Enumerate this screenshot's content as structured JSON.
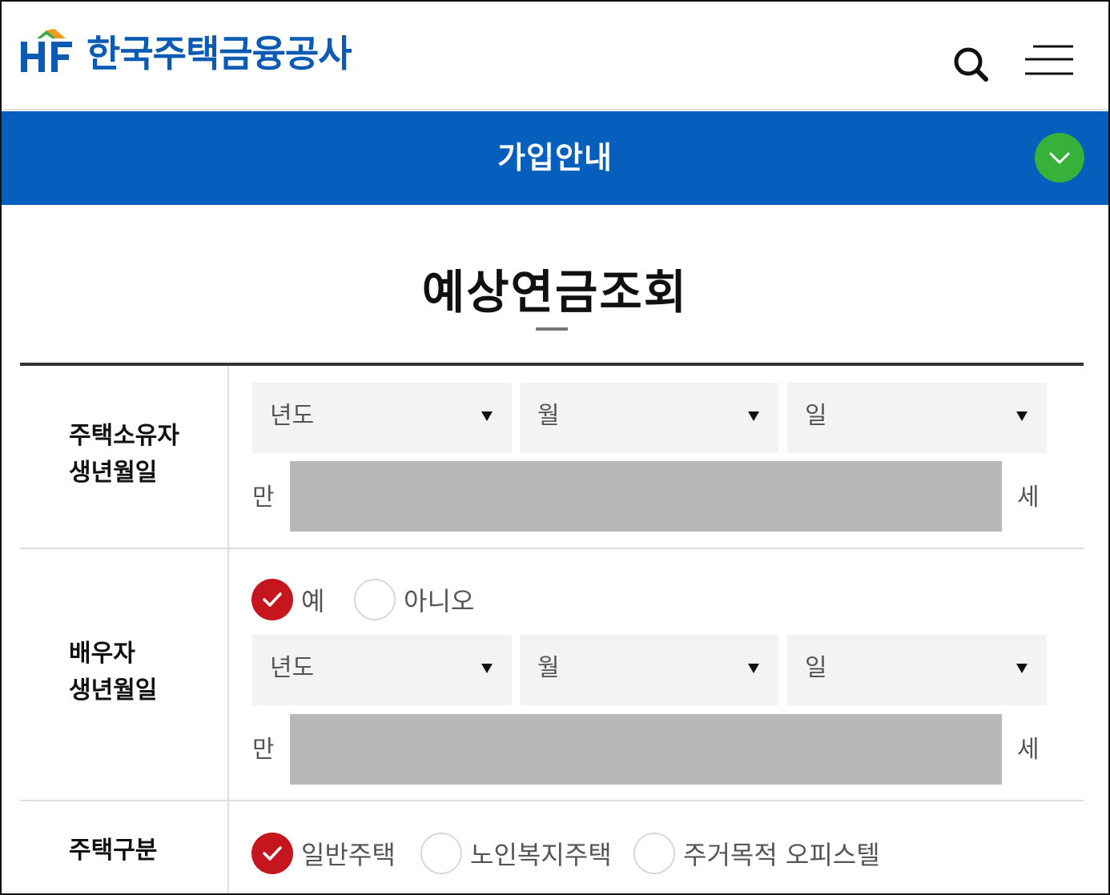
{
  "header": {
    "logo_text": "한국주택금융공사",
    "logo_mark": "HF"
  },
  "bluebar": {
    "title": "가입안내"
  },
  "page": {
    "title": "예상연금조회"
  },
  "owner": {
    "label_line1": "주택소유자",
    "label_line2": "생년월일",
    "year": "년도",
    "month": "월",
    "day": "일",
    "age_prefix": "만",
    "age_suffix": "세"
  },
  "spouse": {
    "label_line1": "배우자",
    "label_line2": "생년월일",
    "option_yes": "예",
    "option_no": "아니오",
    "selected": "예",
    "year": "년도",
    "month": "월",
    "day": "일",
    "age_prefix": "만",
    "age_suffix": "세"
  },
  "house_type": {
    "label": "주택구분",
    "options": [
      "일반주택",
      "노인복지주택",
      "주거목적 오피스텔"
    ],
    "selected": "일반주택"
  },
  "colors": {
    "brand_blue": "#065fbc",
    "toggle_green": "#38b13a",
    "check_red": "#c4161c",
    "age_box_gray": "#b8b8b8"
  },
  "icons": [
    "search-icon",
    "hamburger-menu-icon",
    "chevron-down-icon",
    "checkmark-icon"
  ]
}
